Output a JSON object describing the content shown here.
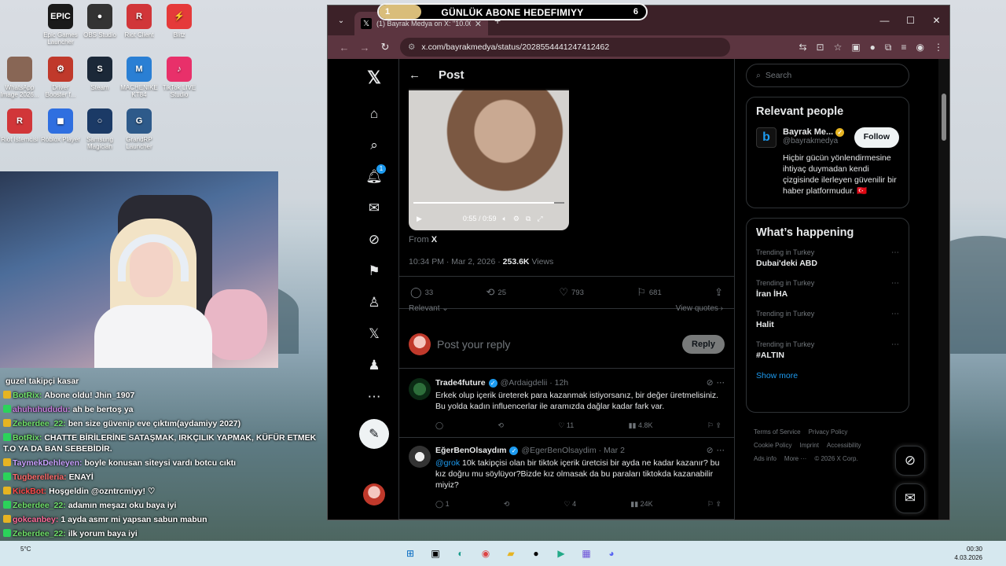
{
  "desktop": {
    "icons": [
      {
        "label": "Epic Games Launcher",
        "color": "#1a1a1a",
        "glyph": "EPIC"
      },
      {
        "label": "OBS Studio",
        "color": "#333",
        "glyph": "●"
      },
      {
        "label": "Riot Client",
        "color": "#d13639",
        "glyph": "R"
      },
      {
        "label": "Blitz",
        "color": "#e53a3a",
        "glyph": "⚡"
      },
      {
        "label": "WhatsApp Image 2026...",
        "color": "#886655",
        "glyph": ""
      },
      {
        "label": "Driver Booster f...",
        "color": "#c0392b",
        "glyph": "⚙"
      },
      {
        "label": "Steam",
        "color": "#1b2838",
        "glyph": "S"
      },
      {
        "label": "MACHENIKE KT84",
        "color": "#2a7fd4",
        "glyph": "M"
      },
      {
        "label": "TikTok LIVE Studio",
        "color": "#e8306a",
        "glyph": "♪"
      },
      {
        "label": "Riot İstemcisi",
        "color": "#d13639",
        "glyph": "R"
      },
      {
        "label": "Roblox Player",
        "color": "#2f6fe0",
        "glyph": "◼"
      },
      {
        "label": "Samsung Magician",
        "color": "#1b3a66",
        "glyph": "○"
      },
      {
        "label": "GrandRP Launcher",
        "color": "#2e5a8a",
        "glyph": "G"
      }
    ]
  },
  "goal": {
    "current": "1",
    "title": "GÜNLÜK ABONE HEDEFIMIYY",
    "target": "6",
    "progress_fraction": 0.16
  },
  "browser": {
    "tab_title": "(1) Bayrak Medya on X: \"10.000 tl...",
    "url": "x.com/bayrakmedya/status/2028554441247412462"
  },
  "x": {
    "header": "Post",
    "notif_count": "1",
    "video_time": "0:55 / 0:59",
    "from_label": "From",
    "from_source": "X",
    "date": "10:34 PM · Mar 2, 2026 ·",
    "views_count": "253.6K",
    "views_label": "Views",
    "stats": {
      "replies": "33",
      "reposts": "25",
      "likes": "793",
      "bookmarks": "681"
    },
    "sort_label": "Relevant",
    "view_quotes": "View quotes",
    "reply_placeholder": "Post your reply",
    "reply_button": "Reply",
    "tweets": [
      {
        "name": "Trade4future",
        "handle": "@Ardaigdelii · 12h",
        "mention": "",
        "text": "Erkek olup içerik üreterek para kazanmak istiyorsanız, bir değer üretmelisiniz. Bu yolda kadın influencerlar ile aramızda dağlar kadar fark var.",
        "replies": "",
        "reposts": "",
        "likes": "11",
        "views": "4.8K"
      },
      {
        "name": "EğerBenOlsaydım",
        "handle": "@EgerBenOlsaydim · Mar 2",
        "mention": "@grok",
        "text": "10k takipçisi olan bir tiktok içerik üretcisi bir ayda ne kadar kazanır? bu kız doğru mu söylüyor?Bizde kız olmasak da bu paraları tiktokda kazanabilir miyiz?",
        "replies": "1",
        "reposts": "",
        "likes": "4",
        "views": "24K"
      }
    ],
    "search_placeholder": "Search",
    "relevant_people": {
      "title": "Relevant people",
      "name": "Bayrak Me...",
      "handle": "@bayrakmedya",
      "follow": "Follow",
      "bio": "Hiçbir gücün yönlendirmesine ihtiyaç duymadan kendi çizgisinde ilerleyen güvenilir bir haber platformudur. 🇹🇷"
    },
    "happening": {
      "title": "What’s happening",
      "trends": [
        {
          "context": "Trending in Turkey",
          "topic": "Dubai'deki ABD"
        },
        {
          "context": "Trending in Turkey",
          "topic": "İran İHA"
        },
        {
          "context": "Trending in Turkey",
          "topic": "Halit"
        },
        {
          "context": "Trending in Turkey",
          "topic": "#ALTIN"
        }
      ],
      "show_more": "Show more"
    },
    "footer": [
      "Terms of Service",
      "Privacy Policy",
      "Cookie Policy",
      "Imprint",
      "Accessibility",
      "Ads info",
      "More ···",
      "© 2026 X Corp."
    ]
  },
  "chat": [
    {
      "user": "",
      "color": "#ffffff",
      "text": "guzel takipçi kasar"
    },
    {
      "user": "BotRix:",
      "color": "#6fe06a",
      "text": "Abone oldu! Jhin_1907"
    },
    {
      "user": "ahuhuhududu:",
      "color": "#c97fe0",
      "text": "ah be bertoş ya"
    },
    {
      "user": "Zeberdee_22:",
      "color": "#6fe06a",
      "text": "ben size güvenip eve çıktım(aydamiyy 2027)"
    },
    {
      "user": "BotRix:",
      "color": "#6fe06a",
      "text": "CHATTE BİRİLERİNE SATAŞMAK, IRKÇILIK YAPMAK, KÜFÜR ETMEK T.O YA DA BAN SEBEBİDİR."
    },
    {
      "user": "TaymekDehleyen:",
      "color": "#c9a0ff",
      "text": "boyle konusan siteysi vardı botcu cıktı"
    },
    {
      "user": "Tugberelleria:",
      "color": "#ff6b6b",
      "text": "ENAYİ"
    },
    {
      "user": "KickBot:",
      "color": "#ff4a4a",
      "text": "Hoşgeldin @ozntrcmiyy! ♡"
    },
    {
      "user": "Zeberdee_22:",
      "color": "#6fe06a",
      "text": "adamın meşazı oku baya iyi"
    },
    {
      "user": "gokcanbey:",
      "color": "#ff6b9a",
      "text": "1 ayda asmr mi yapsan sabun mabun"
    },
    {
      "user": "Zeberdee_22:",
      "color": "#6fe06a",
      "text": "ilk yorum baya iyi"
    }
  ],
  "taskbar": {
    "time": "00:30",
    "date": "4.03.2026",
    "weather": "5°C"
  }
}
